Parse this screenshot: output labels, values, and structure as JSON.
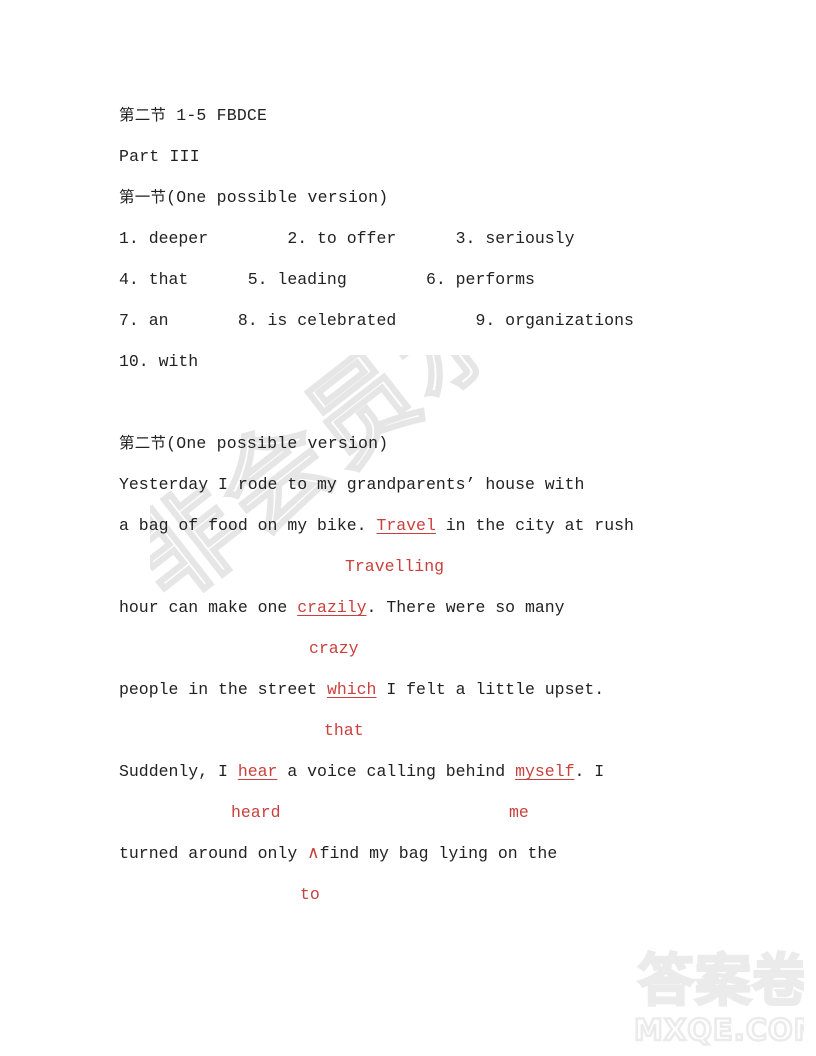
{
  "document": {
    "heading_lines": [
      {
        "cn": "第二节",
        "en": " 1-5 FBDCE"
      },
      {
        "cn": "",
        "en": "Part III"
      },
      {
        "cn": "第一节",
        "en": "(One possible version)"
      }
    ],
    "answers": [
      {
        "row": "1. deeper        2. to offer      3. seriously"
      },
      {
        "row": "4. that      5. leading        6. performs"
      },
      {
        "row": "7. an       8. is celebrated        9. organizations"
      },
      {
        "row": "10. with"
      }
    ],
    "section2_heading": {
      "cn": "第二节",
      "en": "(One possible version)"
    },
    "essay": {
      "line1": {
        "pre": "Yesterday I rode to my grandparents’ house with",
        "err": "",
        "post": ""
      },
      "line2": {
        "pre": "a bag of food on my bike. ",
        "err": "Travel",
        "post": " in the city at rush"
      },
      "line2_correction": "Travelling",
      "line3": {
        "pre": "hour can make one ",
        "err": "crazily",
        "post": ". There were so many"
      },
      "line3_correction": "crazy",
      "line4": {
        "pre": "people in the street ",
        "err": "which",
        "post": " I felt a little upset."
      },
      "line4_correction": "that",
      "line5": {
        "pre": "Suddenly, I ",
        "err": "hear",
        "mid": " a voice calling behind ",
        "err2": "myself",
        "post": ". I"
      },
      "line5_correction_a": "heard",
      "line5_correction_b": "me",
      "line6": {
        "pre": "turned around only ",
        "caret": "∧",
        "post": "find my bag lying on the"
      },
      "line6_correction": "to"
    }
  },
  "watermarks": {
    "diagonal_text": "非会员水印",
    "corner_logo_text": "答案卷",
    "corner_site_text": "MXQE.COM",
    "diagonal_color": "#e8e8e8",
    "corner_color": "#ededed"
  },
  "colors": {
    "ink": "#222222",
    "correction_red": "#c9403c",
    "page_background": "#ffffff"
  }
}
